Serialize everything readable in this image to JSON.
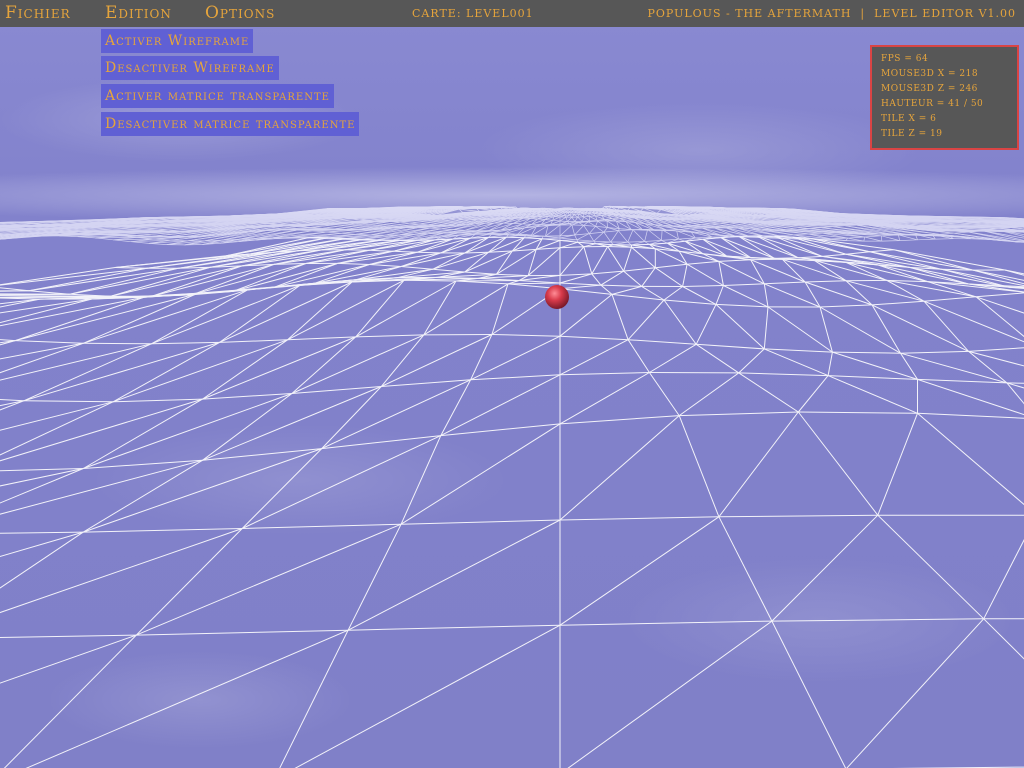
{
  "menubar": {
    "menus": [
      "Fichier",
      "Edition",
      "Options"
    ],
    "map_label": "Carte: Level001",
    "app_title": "Populous - The Aftermath",
    "separator": "|",
    "editor_version": "Level Editor v1.00"
  },
  "dropdown": {
    "items": [
      "Activer Wireframe",
      "Desactiver Wireframe",
      "Activer matrice transparente",
      "Desactiver matrice transparente"
    ]
  },
  "info_panel": {
    "lines": [
      "FPS = 64",
      "MOUSE3D X = 218",
      "MOUSE3D Z = 246",
      "HAUTEUR = 41 / 50",
      "TILE X = 6",
      "TILE Z = 19"
    ]
  },
  "colors": {
    "menu_text": "#e5a43c",
    "menu_bg": "#575757",
    "dropdown_bg": "#6060d4",
    "panel_border": "#d94444",
    "sky": "#8282cc",
    "wireframe": "#ffffff",
    "marker": "#d83a4a"
  }
}
